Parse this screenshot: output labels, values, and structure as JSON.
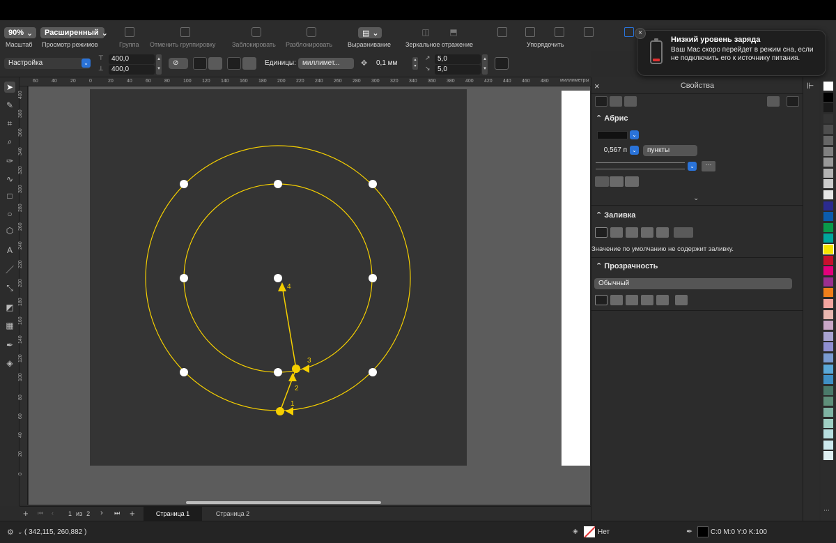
{
  "toolbar": {
    "zoom_value": "90%",
    "zoom_label": "Масштаб",
    "view_mode_value": "Расширенный",
    "view_mode_label": "Просмотр режимов",
    "group_label": "Группа",
    "ungroup_label": "Отменить группировку",
    "lock_label": "Заблокировать",
    "unlock_label": "Разблокировать",
    "align_label": "Выравнивание",
    "mirror_label": "Зеркальное отражение",
    "arrange_label": "Упорядочить"
  },
  "property_bar": {
    "preset": "Настройка",
    "width": "400,0",
    "height": "400,0",
    "units_label": "Единицы:",
    "units_value": "миллимет...",
    "nudge": "0,1 мм",
    "dup_x": "5,0",
    "dup_y": "5,0"
  },
  "ruler": {
    "unit_label": "миллиметры",
    "h_ticks": [
      "60",
      "40",
      "20",
      "0",
      "20",
      "40",
      "60",
      "80",
      "100",
      "120",
      "140",
      "160",
      "180",
      "200",
      "220",
      "240",
      "260",
      "280",
      "300",
      "320",
      "340",
      "360",
      "380",
      "400",
      "420",
      "440",
      "460",
      "480"
    ],
    "v_ticks": [
      "400",
      "380",
      "360",
      "340",
      "320",
      "300",
      "280",
      "260",
      "240",
      "220",
      "200",
      "180",
      "160",
      "140",
      "120",
      "100",
      "80",
      "60",
      "40",
      "20",
      "0"
    ]
  },
  "drawing": {
    "stroke_color": "#f5cf00",
    "markers": [
      "1",
      "2",
      "3",
      "4"
    ]
  },
  "pages": {
    "counter_current": "1",
    "counter_of": "из",
    "counter_total": "2",
    "tab1": "Страница 1",
    "tab2": "Страница 2"
  },
  "status": {
    "coords": "( 342,115, 260,882 )",
    "fill_label": "Нет",
    "outline_color": "C:0 M:0 Y:0 K:100"
  },
  "panel": {
    "title": "Свойства",
    "outline_header": "Абрис",
    "outline_width": "0,567 п",
    "outline_units": "пункты",
    "fill_header": "Заливка",
    "fill_note": "Значение по умолчанию не содержит заливку.",
    "transparency_header": "Прозрачность",
    "transparency_mode": "Обычный"
  },
  "notification": {
    "title": "Низкий уровень заряда",
    "body": "Ваш Mac скоро перейдет в режим сна, если не подключить его к источнику питания."
  },
  "palette_colors": [
    "#ffffff",
    "#000000",
    "#1a1a1a",
    "#333333",
    "#4d4d4d",
    "#666666",
    "#808080",
    "#999999",
    "#b3b3b3",
    "#cccccc",
    "#e6e6e6",
    "#2b2b8f",
    "#0b5cad",
    "#0a9a4a",
    "#00a79d",
    "#f5e400",
    "#c8102e",
    "#e4007c",
    "#9b2f8f",
    "#f07f1a",
    "#f4a6a0",
    "#e9b7b0",
    "#c9a7c7",
    "#a8a3d1",
    "#8f8fd1",
    "#7a9bd1",
    "#5aa8d8",
    "#3f8fc4",
    "#4a7a6a",
    "#5f8f7a",
    "#7fb3a3",
    "#9fcfc3",
    "#b8dfe0",
    "#cde9ee",
    "#dfeff2"
  ]
}
